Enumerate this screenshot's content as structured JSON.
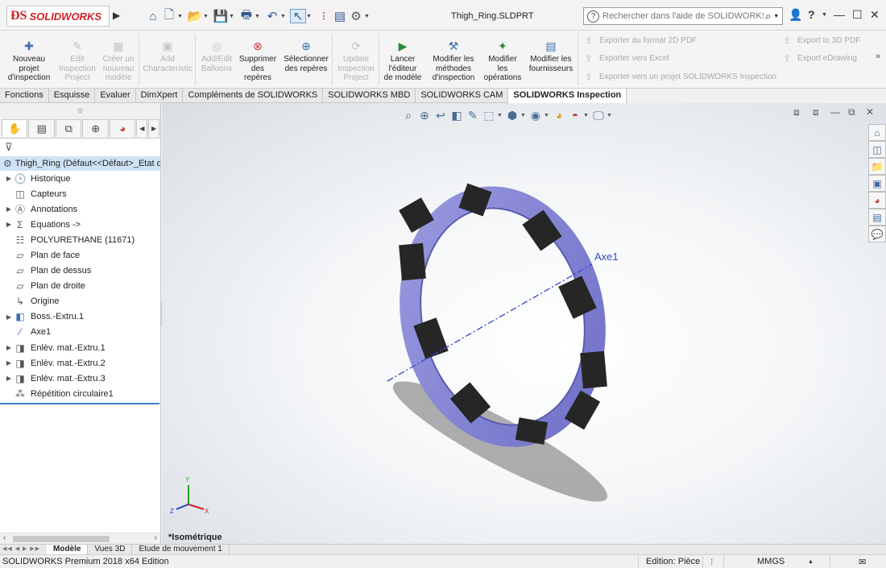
{
  "app": {
    "logo_text": "SOLIDWORKS",
    "document_title": "Thigh_Ring.SLDPRT"
  },
  "quick_access": {
    "icons": [
      "home-icon",
      "new-document-icon",
      "open-icon",
      "save-icon",
      "print-icon",
      "undo-icon",
      "select-icon",
      "traffic-light-icon",
      "file-properties-icon",
      "options-gear-icon"
    ]
  },
  "search": {
    "placeholder": "Rechercher dans l'aide de SOLIDWORKS"
  },
  "ribbon": {
    "buttons": [
      {
        "label": "Nouveau\nprojet\nd'inspection",
        "enabled": true,
        "icon": "new-inspection-project-icon"
      },
      {
        "label": "Edit\nInspection\nProject",
        "enabled": false,
        "icon": "edit-inspection-project-icon"
      },
      {
        "label": "Créer un\nnouveau\nmodèle",
        "enabled": false,
        "icon": "create-template-icon"
      },
      {
        "label": "Add\nCharacteristic",
        "enabled": false,
        "icon": "add-characteristic-icon"
      },
      {
        "label": "Add/Edit\nBalloons",
        "enabled": false,
        "icon": "add-edit-balloons-icon"
      },
      {
        "label": "Supprimer\ndes\nrepères",
        "enabled": true,
        "icon": "delete-balloons-icon"
      },
      {
        "label": "Sélectionner\ndes repères",
        "enabled": true,
        "icon": "select-balloons-icon"
      },
      {
        "label": "Update\nInspection\nProject",
        "enabled": false,
        "icon": "update-inspection-project-icon"
      },
      {
        "label": "Lancer\nl'éditeur\nde modèle",
        "enabled": true,
        "icon": "launch-template-editor-icon"
      },
      {
        "label": "Modifier les\nméthodes\nd'inspection",
        "enabled": true,
        "icon": "edit-inspection-methods-icon"
      },
      {
        "label": "Modifier\nles\nopérations",
        "enabled": true,
        "icon": "edit-operations-icon"
      },
      {
        "label": "Modifier les\nfournisseurs",
        "enabled": true,
        "icon": "edit-vendors-icon"
      }
    ],
    "export_left": [
      "Exporter au format 2D PDF",
      "Exporter vers Excel",
      "Exporter vers un projet SOLIDWORKS Inspection"
    ],
    "export_right": [
      "Export to 3D PDF",
      "Export eDrawing"
    ],
    "more": "»"
  },
  "tabs": [
    {
      "label": "Fonctions",
      "active": false
    },
    {
      "label": "Esquisse",
      "active": false
    },
    {
      "label": "Evaluer",
      "active": false
    },
    {
      "label": "DimXpert",
      "active": false
    },
    {
      "label": "Compléments de SOLIDWORKS",
      "active": false
    },
    {
      "label": "SOLIDWORKS MBD",
      "active": false
    },
    {
      "label": "SOLIDWORKS CAM",
      "active": false
    },
    {
      "label": "SOLIDWORKS Inspection",
      "active": true
    }
  ],
  "feature_tree": {
    "root": "Thigh_Ring  (Défaut<<Défaut>_Etat d",
    "items": [
      {
        "label": "Historique",
        "expandable": true,
        "icon": "history-folder-icon"
      },
      {
        "label": "Capteurs",
        "expandable": false,
        "icon": "sensors-icon"
      },
      {
        "label": "Annotations",
        "expandable": true,
        "icon": "annotations-icon"
      },
      {
        "label": "Equations ->",
        "expandable": true,
        "icon": "equations-icon"
      },
      {
        "label": "POLYURETHANE (11671)",
        "expandable": false,
        "icon": "material-icon"
      },
      {
        "label": "Plan de face",
        "expandable": false,
        "icon": "plane-icon"
      },
      {
        "label": "Plan de dessus",
        "expandable": false,
        "icon": "plane-icon"
      },
      {
        "label": "Plan de droite",
        "expandable": false,
        "icon": "plane-icon"
      },
      {
        "label": "Origine",
        "expandable": false,
        "icon": "origin-icon"
      },
      {
        "label": "Boss.-Extru.1",
        "expandable": true,
        "icon": "boss-extrude-icon"
      },
      {
        "label": "Axe1",
        "expandable": false,
        "icon": "axis-icon"
      },
      {
        "label": "Enlèv. mat.-Extru.1",
        "expandable": true,
        "icon": "cut-extrude-icon"
      },
      {
        "label": "Enlèv. mat.-Extru.2",
        "expandable": true,
        "icon": "cut-extrude-icon"
      },
      {
        "label": "Enlèv. mat.-Extru.3",
        "expandable": true,
        "icon": "cut-extrude-icon"
      },
      {
        "label": "Répétition circulaire1",
        "expandable": false,
        "icon": "circular-pattern-icon"
      }
    ]
  },
  "viewport": {
    "axis_label": "Axe1",
    "view_name": "*Isométrique",
    "triad": {
      "x": "X",
      "y": "Y",
      "z": "Z"
    }
  },
  "bottom_tabs": [
    {
      "label": "Modèle",
      "active": true
    },
    {
      "label": "Vues 3D",
      "active": false
    },
    {
      "label": "Etude de mouvement 1",
      "active": false
    }
  ],
  "status": {
    "edition_info": "SOLIDWORKS Premium 2018 x64 Edition",
    "mode": "Edition: Pièce",
    "units": "MMGS"
  }
}
